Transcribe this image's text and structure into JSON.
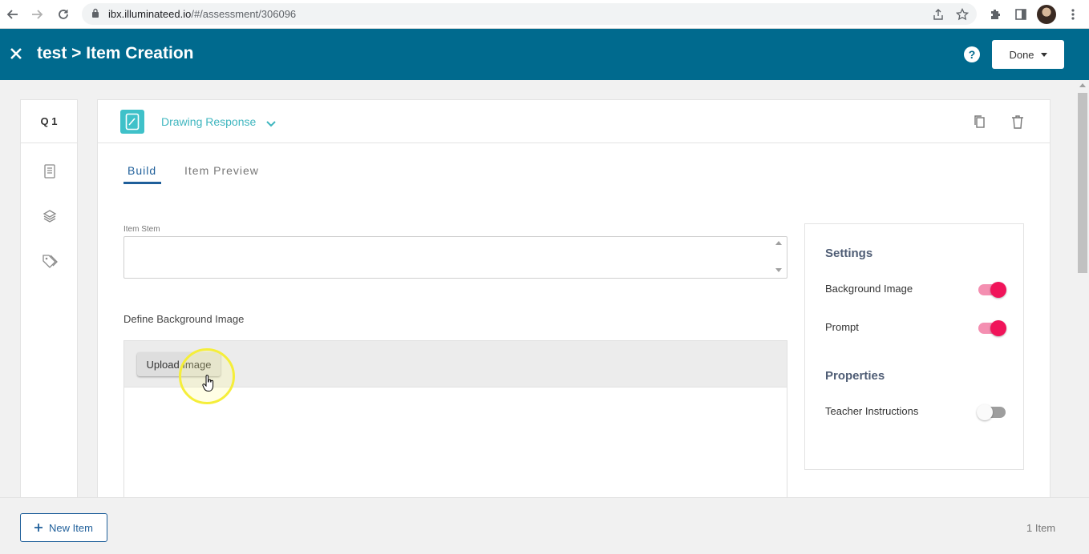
{
  "browser": {
    "url_host": "ibx.illuminateed.io",
    "url_path": "/#/assessment/306096"
  },
  "header": {
    "title": "test > Item Creation",
    "help_label": "?",
    "done_label": "Done"
  },
  "rail": {
    "question_label": "Q 1"
  },
  "item": {
    "type_label": "Drawing Response"
  },
  "tabs": [
    {
      "label": "Build",
      "active": true
    },
    {
      "label": "Item Preview",
      "active": false
    }
  ],
  "form": {
    "stem_label": "Item Stem",
    "stem_value": "",
    "define_bg_label": "Define Background Image",
    "upload_label": "Upload Image"
  },
  "settings": {
    "settings_heading": "Settings",
    "background_image_label": "Background Image",
    "background_image_on": true,
    "prompt_label": "Prompt",
    "prompt_on": true,
    "properties_heading": "Properties",
    "teacher_instructions_label": "Teacher Instructions",
    "teacher_instructions_on": false
  },
  "footer": {
    "new_item_label": "New Item",
    "item_count": "1 Item"
  },
  "colors": {
    "header_bg": "#006a8e",
    "accent_teal": "#3fb6bf",
    "tab_active": "#1f5f9a",
    "toggle_on": "#f0145a"
  }
}
